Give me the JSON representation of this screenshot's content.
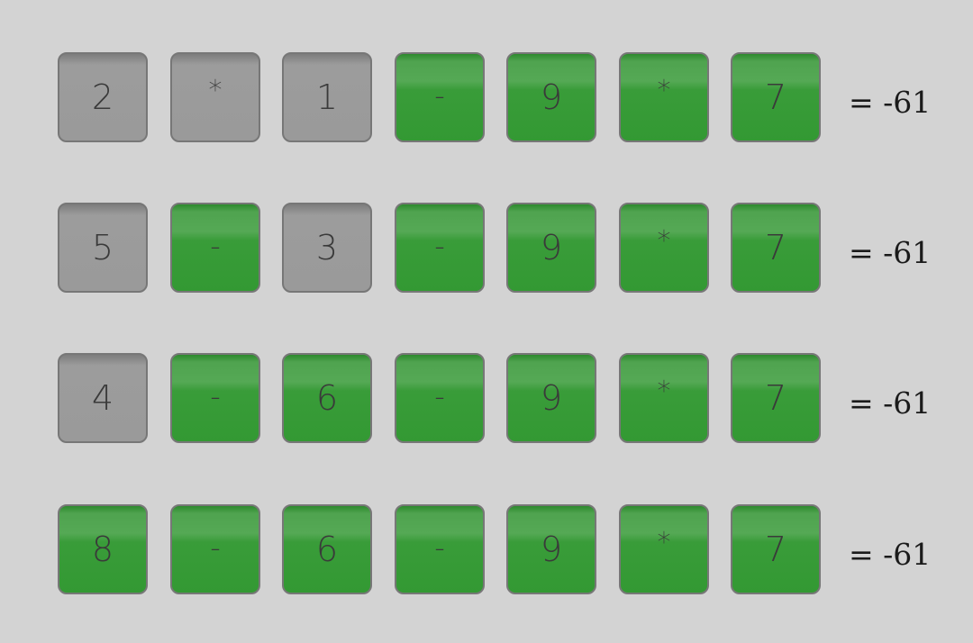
{
  "rows": [
    {
      "tiles": [
        {
          "text": "2",
          "state": "grey"
        },
        {
          "text": "*",
          "state": "grey"
        },
        {
          "text": "1",
          "state": "grey"
        },
        {
          "text": "-",
          "state": "green"
        },
        {
          "text": "9",
          "state": "green"
        },
        {
          "text": "*",
          "state": "green"
        },
        {
          "text": "7",
          "state": "green"
        }
      ],
      "result": "= -61"
    },
    {
      "tiles": [
        {
          "text": "5",
          "state": "grey"
        },
        {
          "text": "-",
          "state": "green"
        },
        {
          "text": "3",
          "state": "grey"
        },
        {
          "text": "-",
          "state": "green"
        },
        {
          "text": "9",
          "state": "green"
        },
        {
          "text": "*",
          "state": "green"
        },
        {
          "text": "7",
          "state": "green"
        }
      ],
      "result": "= -61"
    },
    {
      "tiles": [
        {
          "text": "4",
          "state": "grey"
        },
        {
          "text": "-",
          "state": "green"
        },
        {
          "text": "6",
          "state": "green"
        },
        {
          "text": "-",
          "state": "green"
        },
        {
          "text": "9",
          "state": "green"
        },
        {
          "text": "*",
          "state": "green"
        },
        {
          "text": "7",
          "state": "green"
        }
      ],
      "result": "= -61"
    },
    {
      "tiles": [
        {
          "text": "8",
          "state": "green"
        },
        {
          "text": "-",
          "state": "green"
        },
        {
          "text": "6",
          "state": "green"
        },
        {
          "text": "-",
          "state": "green"
        },
        {
          "text": "9",
          "state": "green"
        },
        {
          "text": "*",
          "state": "green"
        },
        {
          "text": "7",
          "state": "green"
        }
      ],
      "result": "= -61"
    }
  ],
  "colors": {
    "background": "#d3d3d3",
    "correct": "#339933",
    "absent": "#9a9a9a",
    "tile_border": "#777777",
    "tile_text": "#3a3a3a"
  }
}
